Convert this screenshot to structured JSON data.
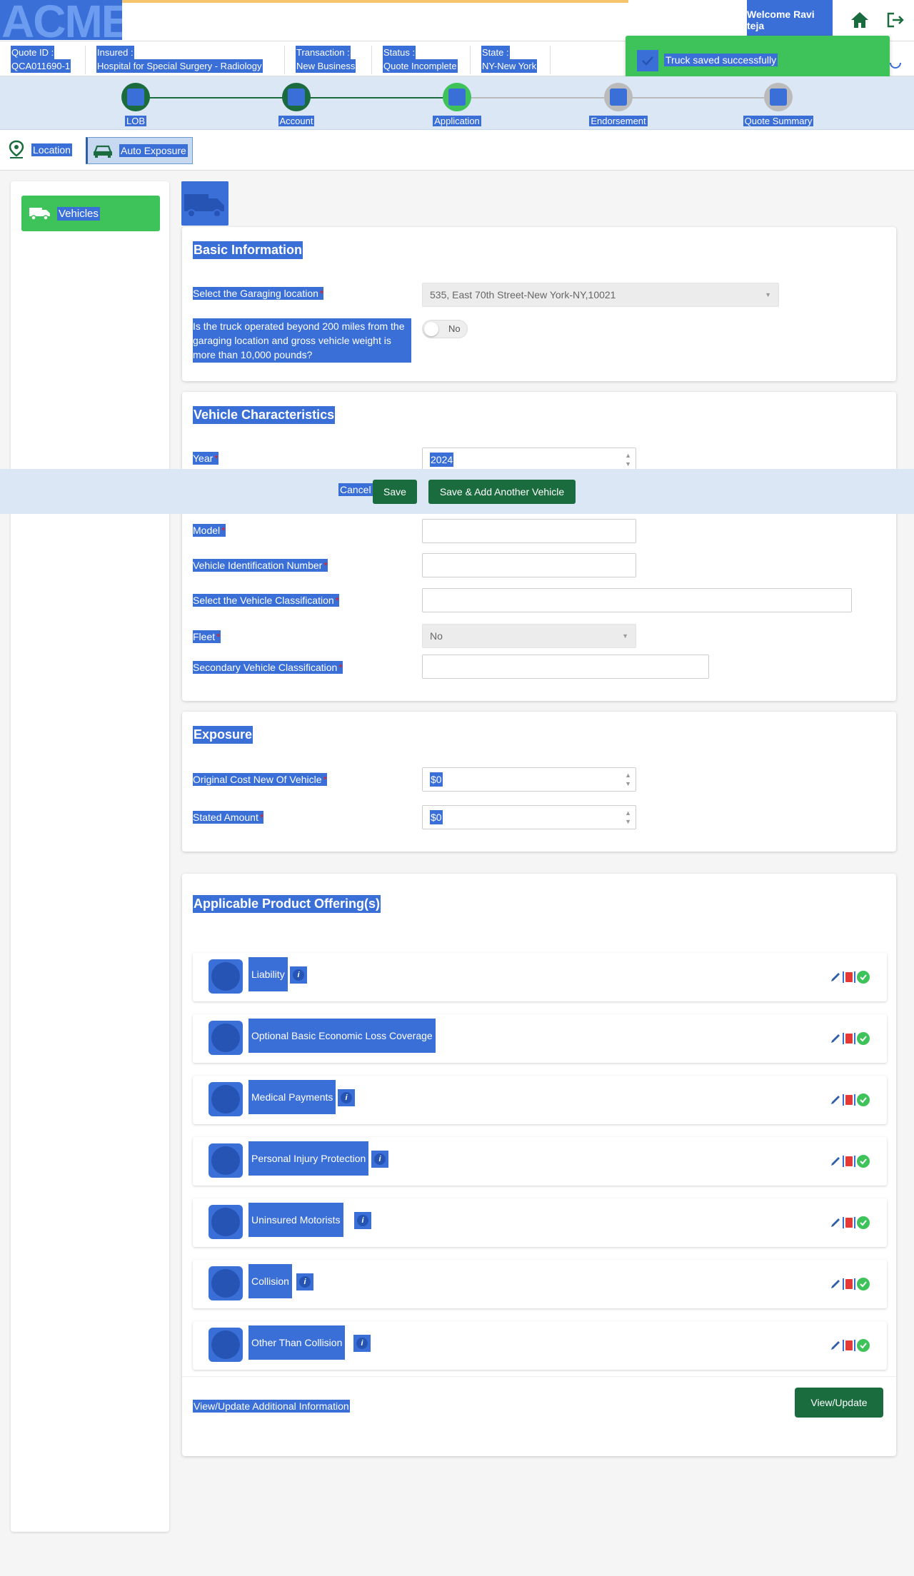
{
  "header": {
    "logo_text": "ACME",
    "welcome": "Welcome Ravi teja"
  },
  "quote_info": [
    {
      "label": "Quote ID :",
      "value": "QCA011690-1"
    },
    {
      "label": "Insured :",
      "value": "Hospital for Special Surgery - Radiology"
    },
    {
      "label": "Transaction :",
      "value": "New Business"
    },
    {
      "label": "Status :",
      "value": "Quote Incomplete"
    },
    {
      "label": "State :",
      "value": "NY-New York"
    }
  ],
  "toast": {
    "message": "Truck saved successfully"
  },
  "steps": [
    {
      "label": "LOB",
      "state": "completed"
    },
    {
      "label": "Account",
      "state": "completed"
    },
    {
      "label": "Application",
      "state": "current"
    },
    {
      "label": "Endorsement",
      "state": "pending"
    },
    {
      "label": "Quote Summary",
      "state": "pending"
    }
  ],
  "tabs": {
    "location": "Location",
    "auto_exposure": "Auto Exposure"
  },
  "sidebar": {
    "vehicles": "Vehicles"
  },
  "basic_info": {
    "title": "Basic Information",
    "garaging_label": "Select the Garaging location",
    "garaging_value": "535, East 70th Street-New York-NY,10021",
    "truck_question": "Is the truck operated beyond 200 miles from the garaging location and gross vehicle weight is more than 10,000 pounds?",
    "truck_toggle": "No"
  },
  "vehicle_char": {
    "title": "Vehicle Characteristics",
    "year_label": "Year",
    "year_value": "2024",
    "model_label": "Model",
    "vin_label": "Vehicle Identification Number",
    "classification_label": "Select the Vehicle Classification",
    "fleet_label": "Fleet",
    "fleet_value": "No",
    "secondary_label": "Secondary Vehicle Classification"
  },
  "actions": {
    "cancel": "Cancel",
    "save": "Save",
    "save_add": "Save & Add Another Vehicle"
  },
  "exposure": {
    "title": "Exposure",
    "ocn_label": "Original Cost New Of Vehicle",
    "ocn_value": "$0",
    "stated_label": "Stated Amount",
    "stated_value": "$0"
  },
  "offerings": {
    "title": "Applicable Product Offering(s)",
    "items": [
      {
        "name": "Liability",
        "has_info": true
      },
      {
        "name": "Optional Basic Economic Loss Coverage",
        "has_info": false
      },
      {
        "name": "Medical Payments",
        "has_info": true
      },
      {
        "name": "Personal Injury Protection",
        "has_info": true
      },
      {
        "name": "Uninsured Motorists",
        "has_info": true
      },
      {
        "name": "Collision",
        "has_info": true
      },
      {
        "name": "Other Than Collision",
        "has_info": true
      }
    ],
    "additional_label": "View/Update Additional Information",
    "view_update_button": "View/Update"
  },
  "colors": {
    "highlight": "#3b6fd8",
    "green_button": "#1a6b3e",
    "success": "#3ec35a",
    "stepper_bg": "#dbe7f5"
  }
}
